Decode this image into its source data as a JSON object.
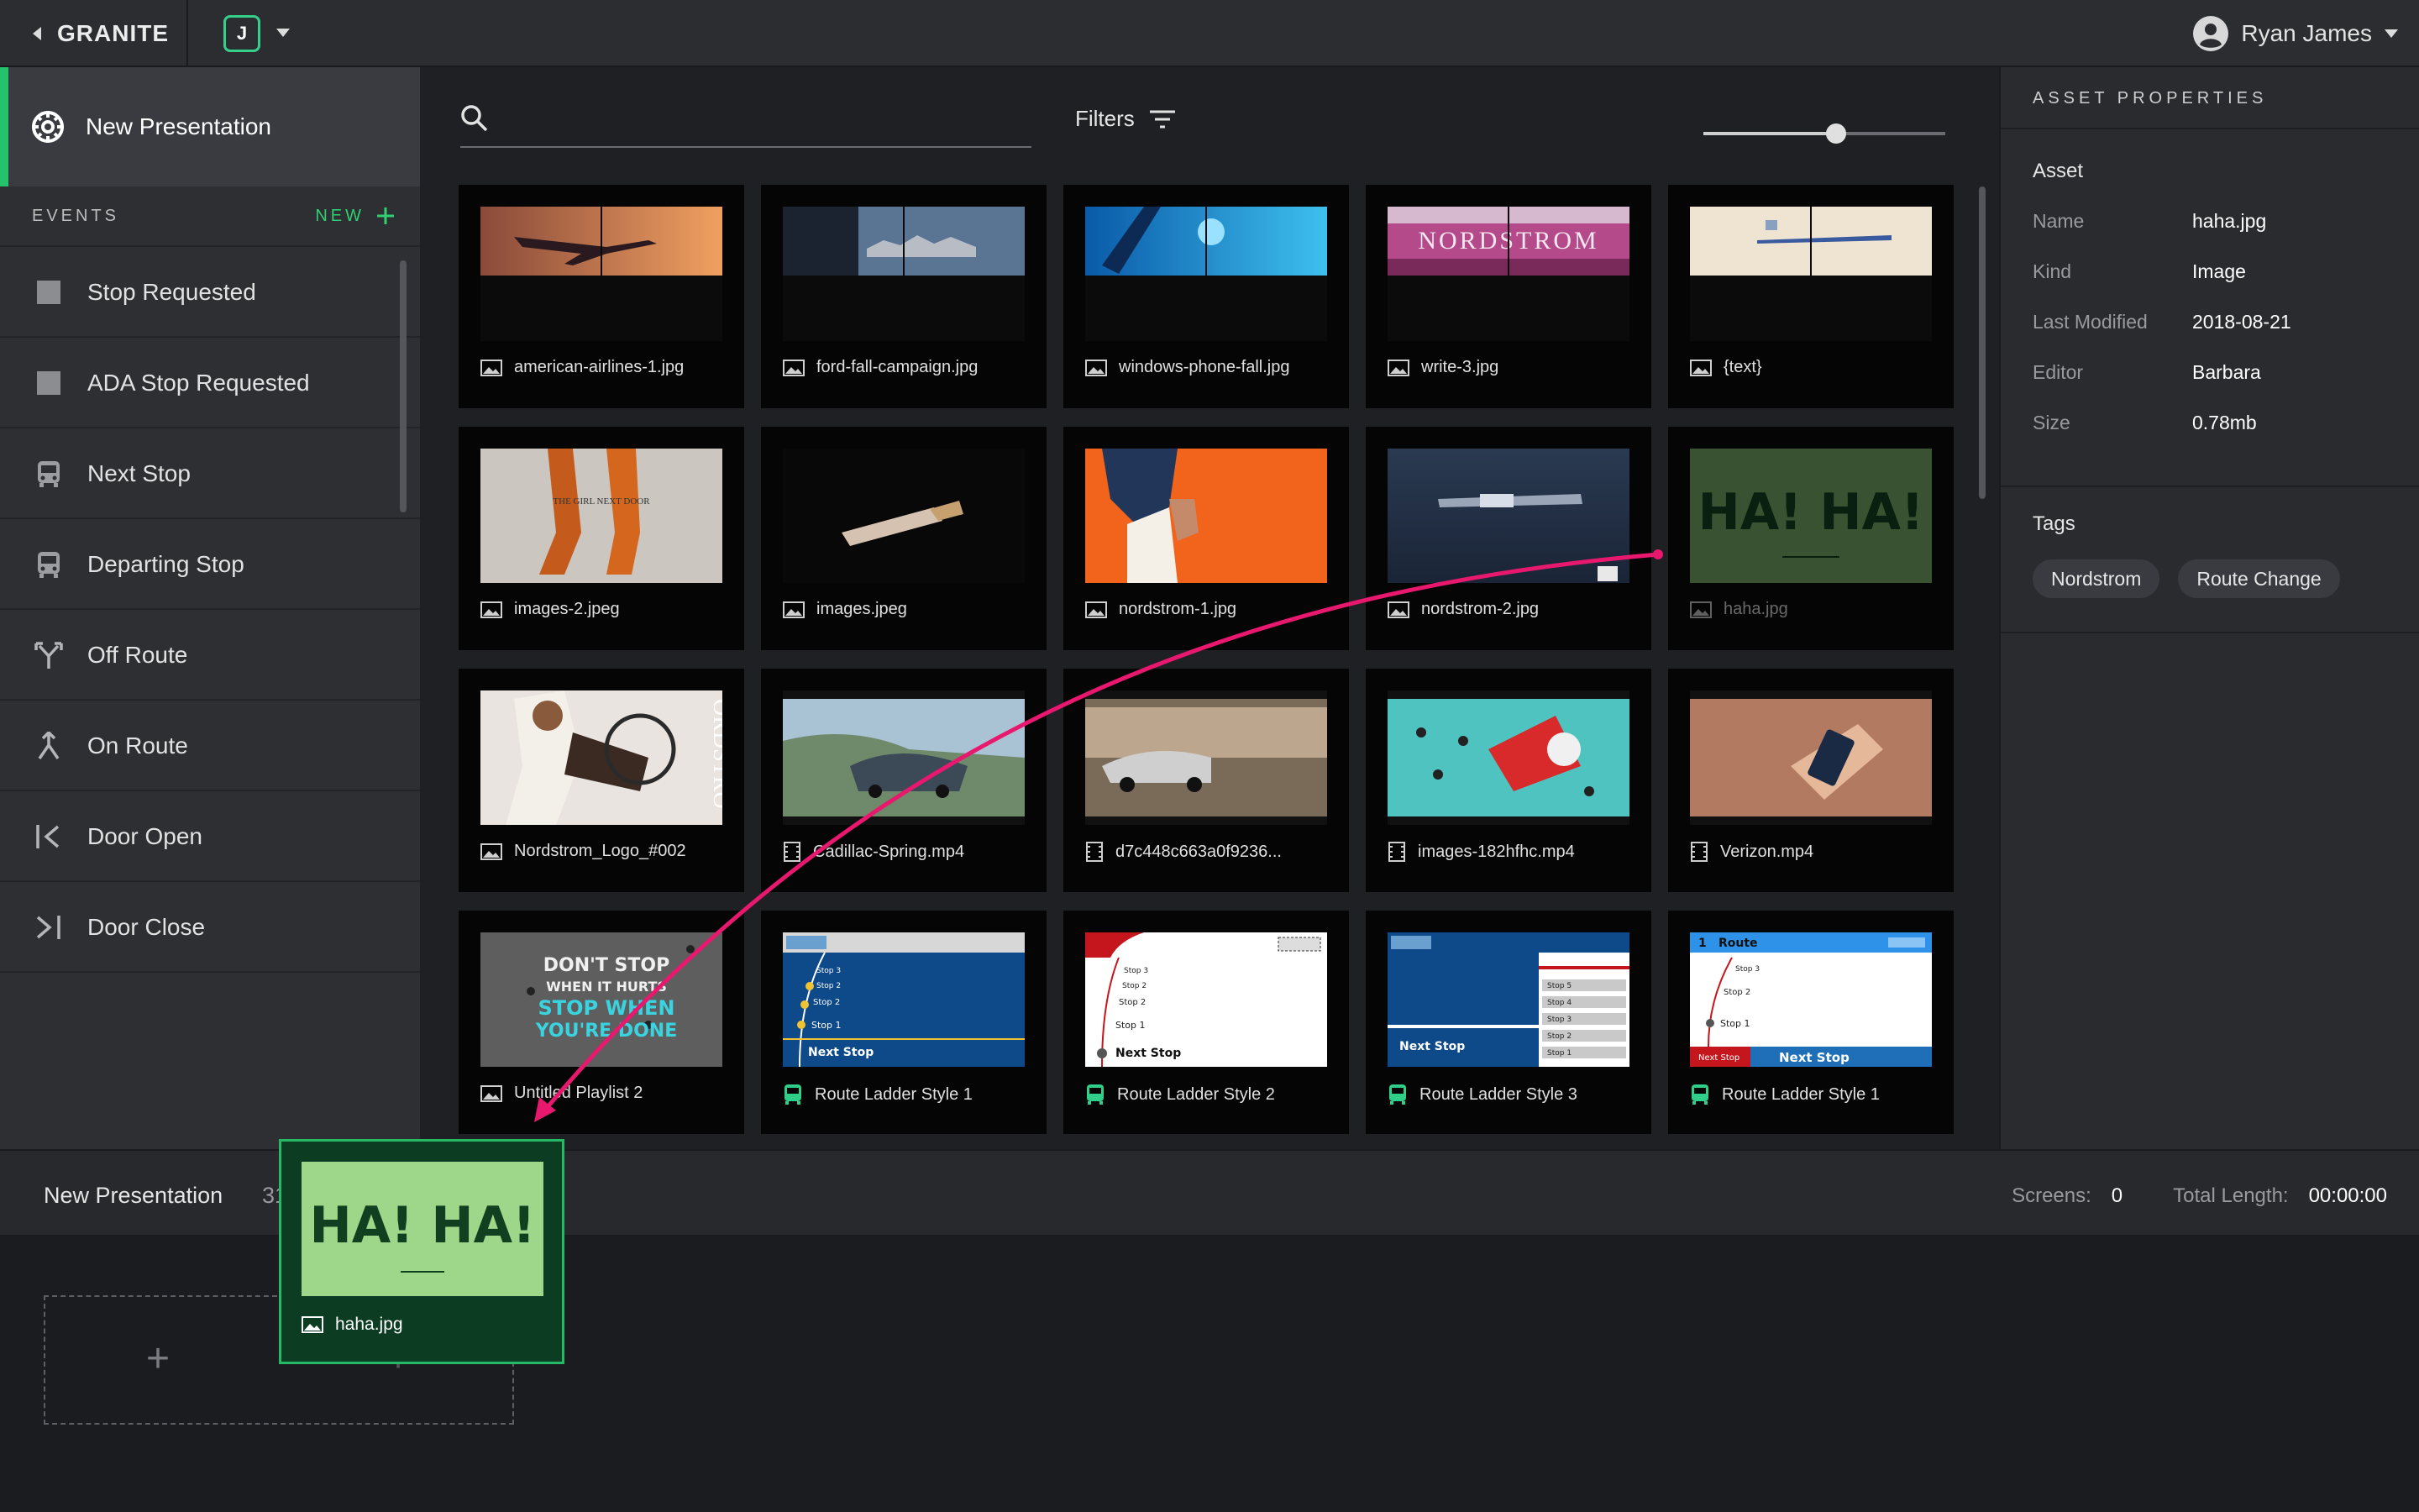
{
  "topbar": {
    "app_title": "GRANITE",
    "workspace_initial": "J",
    "user_name": "Ryan James"
  },
  "sidebar": {
    "presentation_label": "New Presentation",
    "events_label": "EVENTS",
    "new_label": "NEW",
    "events": [
      {
        "label": "Stop Requested",
        "icon": "square-stop-icon"
      },
      {
        "label": "ADA Stop Requested",
        "icon": "square-stop-icon"
      },
      {
        "label": "Next Stop",
        "icon": "bus-icon"
      },
      {
        "label": "Departing Stop",
        "icon": "bus-icon"
      },
      {
        "label": "Off Route",
        "icon": "fork-off-route-icon"
      },
      {
        "label": "On Route",
        "icon": "merge-on-route-icon"
      },
      {
        "label": "Door Open",
        "icon": "door-open-icon"
      },
      {
        "label": "Door Close",
        "icon": "door-close-icon"
      }
    ]
  },
  "toolbar": {
    "search_placeholder": "",
    "search_value": "",
    "filters_label": "Filters",
    "zoom_level": 0.55
  },
  "assets": [
    {
      "name": "american-airlines-1.jpg",
      "kind": "image"
    },
    {
      "name": "ford-fall-campaign.jpg",
      "kind": "image"
    },
    {
      "name": "windows-phone-fall.jpg",
      "kind": "image"
    },
    {
      "name": "write-3.jpg",
      "kind": "image"
    },
    {
      "name": "{text}",
      "kind": "image"
    },
    {
      "name": "images-2.jpeg",
      "kind": "image"
    },
    {
      "name": "images.jpeg",
      "kind": "image"
    },
    {
      "name": "nordstrom-1.jpg",
      "kind": "image"
    },
    {
      "name": "nordstrom-2.jpg",
      "kind": "image"
    },
    {
      "name": "haha.jpg",
      "kind": "image"
    },
    {
      "name": "Nordstrom_Logo_#002",
      "kind": "image"
    },
    {
      "name": "Cadillac-Spring.mp4",
      "kind": "video"
    },
    {
      "name": "d7c448c663a0f9236...",
      "kind": "video"
    },
    {
      "name": "images-182hfhc.mp4",
      "kind": "video"
    },
    {
      "name": "Verizon.mp4",
      "kind": "video"
    },
    {
      "name": "Untitled Playlist 2",
      "kind": "image"
    },
    {
      "name": "Route Ladder Style 1",
      "kind": "route"
    },
    {
      "name": "Route Ladder Style 2",
      "kind": "route"
    },
    {
      "name": "Route Ladder Style 3",
      "kind": "route"
    },
    {
      "name": "Route Ladder Style 1",
      "kind": "route"
    }
  ],
  "thumb_text": {
    "nordstrom": "NORDSTROM",
    "haha": "HA! HA!",
    "dont_stop": "DON'T STOP WHEN IT HURTS STOP WHEN YOU'RE DONE",
    "next_stop": "Next Stop",
    "route": "Route",
    "route_num": "1",
    "stop3": "Stop 3",
    "stop2": "Stop 2",
    "stop1": "Stop 1",
    "stop4": "Stop 4",
    "stop5": "Stop 5",
    "nordstrom_vertical": "ORDSTRO"
  },
  "properties": {
    "title": "ASSET PROPERTIES",
    "section_label": "Asset",
    "rows": [
      {
        "key": "Name",
        "value": "haha.jpg"
      },
      {
        "key": "Kind",
        "value": "Image"
      },
      {
        "key": "Last Modified",
        "value": "2018-08-21"
      },
      {
        "key": "Editor",
        "value": "Barbara"
      },
      {
        "key": "Size",
        "value": "0.78mb"
      }
    ],
    "tags_label": "Tags",
    "tags": [
      "Nordstrom",
      "Route Change"
    ]
  },
  "timeline": {
    "title": "New Presentation",
    "count": "31",
    "screens_label": "Screens:",
    "screens_value": "0",
    "length_label": "Total Length:",
    "length_value": "00:00:00",
    "add_label": "+"
  },
  "drag_ghost": {
    "name": "haha.jpg",
    "thumb_text": "HA! HA!"
  },
  "colors": {
    "accent_green": "#24c26b",
    "drag_arrow": "#e8186e",
    "panel_bg": "#2e2f33"
  }
}
